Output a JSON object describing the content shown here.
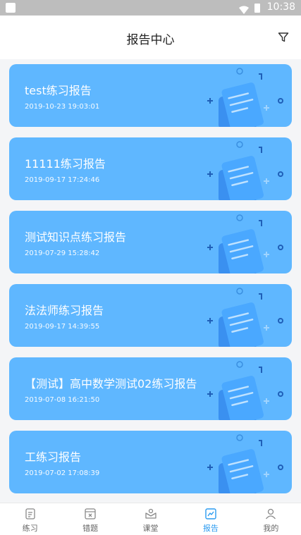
{
  "status_bar": {
    "time": "10:38"
  },
  "header": {
    "title": "报告中心",
    "filter_icon": "filter-icon"
  },
  "reports": [
    {
      "title": "test练习报告",
      "date": "2019-10-23 19:03:01"
    },
    {
      "title": "11111练习报告",
      "date": "2019-09-17 17:24:46"
    },
    {
      "title": "测试知识点练习报告",
      "date": "2019-07-29 15:28:42"
    },
    {
      "title": "法法师练习报告",
      "date": "2019-09-17 14:39:55"
    },
    {
      "title": "【测试】高中数学测试02练习报告",
      "date": "2019-07-08 16:21:50"
    },
    {
      "title": "工练习报告",
      "date": "2019-07-02 17:08:39"
    }
  ],
  "tabbar": {
    "items": [
      {
        "label": "练习",
        "icon": "practice-icon",
        "active": false
      },
      {
        "label": "错题",
        "icon": "wrong-questions-icon",
        "active": false
      },
      {
        "label": "课堂",
        "icon": "classroom-icon",
        "active": false
      },
      {
        "label": "报告",
        "icon": "report-icon",
        "active": true
      },
      {
        "label": "我的",
        "icon": "profile-icon",
        "active": false
      }
    ]
  },
  "colors": {
    "card": "#5fb7ff",
    "accent": "#2a9bf0"
  }
}
